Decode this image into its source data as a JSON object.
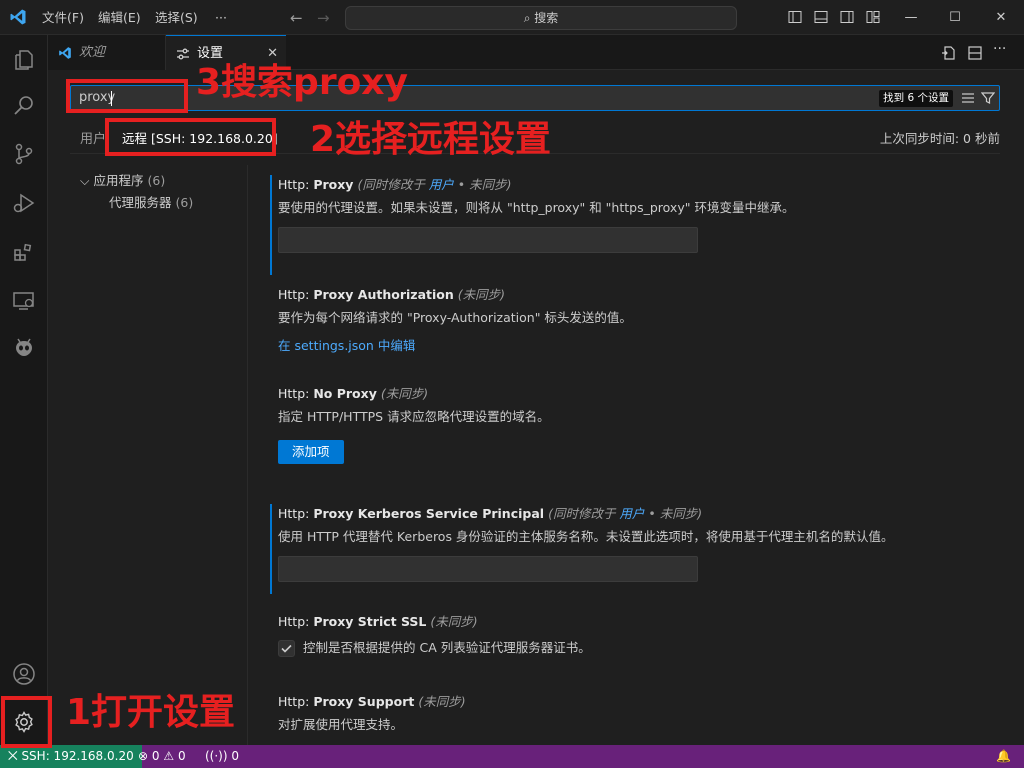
{
  "titlebar": {
    "menus": [
      "文件(F)",
      "编辑(E)",
      "选择(S)",
      "···"
    ],
    "search_label": "搜索",
    "accent": "#0078d4"
  },
  "tabs": [
    {
      "label": "欢迎",
      "icon": "vscode-logo-icon"
    },
    {
      "label": "设置",
      "icon": "settings-sliders-icon"
    }
  ],
  "search": {
    "value": "proxy",
    "results_badge": "找到 6 个设置"
  },
  "scopes": {
    "user": "用户",
    "remote": "远程 [SSH: 192.168.0.20]",
    "last_sync": "上次同步时间: 0 秒前"
  },
  "toc": [
    {
      "label": "应用程序",
      "count": "(6)"
    },
    {
      "label": "代理服务器",
      "count": "(6)"
    }
  ],
  "settings": [
    {
      "category": "Http: ",
      "name": "Proxy",
      "meta_prefix": "(同时修改于 ",
      "meta_link": "用户",
      "meta_suffix": " • 未同步)",
      "description": "要使用的代理设置。如果未设置，则将从 \"http_proxy\" 和 \"https_proxy\" 环境变量中继承。"
    },
    {
      "category": "Http: ",
      "name": "Proxy Authorization",
      "meta": "(未同步)",
      "description": "要作为每个网络请求的 \"Proxy-Authorization\" 标头发送的值。",
      "link": "在 settings.json 中编辑"
    },
    {
      "category": "Http: ",
      "name": "No Proxy",
      "meta": "(未同步)",
      "description": "指定 HTTP/HTTPS 请求应忽略代理设置的域名。",
      "button": "添加项"
    },
    {
      "category": "Http: ",
      "name": "Proxy Kerberos Service Principal",
      "meta_prefix": "(同时修改于 ",
      "meta_link": "用户",
      "meta_suffix": " • 未同步)",
      "description": "使用 HTTP 代理替代 Kerberos 身份验证的主体服务名称。未设置此选项时，将使用基于代理主机名的默认值。"
    },
    {
      "category": "Http: ",
      "name": "Proxy Strict SSL",
      "meta": "(未同步)",
      "checkbox_label": "控制是否根据提供的 CA 列表验证代理服务器证书。",
      "checked": true
    },
    {
      "category": "Http: ",
      "name": "Proxy Support",
      "meta": "(未同步)",
      "description": "对扩展使用代理支持。"
    }
  ],
  "statusbar": {
    "remote": "SSH: 192.168.0.20",
    "errors": "0",
    "warnings": "0",
    "ports": "0",
    "remote_color": "#16825d",
    "bar_color": "#68217a"
  },
  "annotations": {
    "step1": "1打开设置",
    "step2": "2选择远程设置",
    "step3": "3搜索proxy",
    "color": "#e62020"
  }
}
